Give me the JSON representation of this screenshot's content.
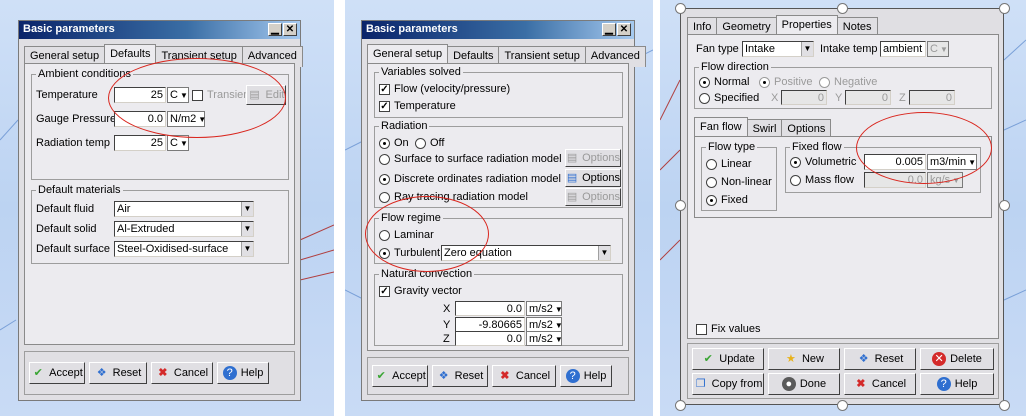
{
  "colors": {
    "title_bar": "#0a246a",
    "accent_ring": "#d9251d",
    "background_cad": "#c9dbf5"
  },
  "dialog1": {
    "title": "Basic parameters",
    "tabs": [
      "General setup",
      "Defaults",
      "Transient setup",
      "Advanced"
    ],
    "active_tab": "Defaults",
    "ambient": {
      "legend": "Ambient conditions",
      "temperature_label": "Temperature",
      "temperature_value": "25",
      "temperature_unit": "C",
      "transient_label": "Transient",
      "edit_label": "Edit",
      "gauge_label": "Gauge Pressure",
      "gauge_value": "0.0",
      "gauge_unit": "N/m2",
      "radiation_label": "Radiation temp",
      "radiation_value": "25",
      "radiation_unit": "C"
    },
    "materials": {
      "legend": "Default materials",
      "fluid_label": "Default fluid",
      "fluid_value": "Air",
      "solid_label": "Default solid",
      "solid_value": "Al-Extruded",
      "surface_label": "Default surface",
      "surface_value": "Steel-Oxidised-surface"
    },
    "buttons": {
      "accept": "Accept",
      "reset": "Reset",
      "cancel": "Cancel",
      "help": "Help"
    }
  },
  "dialog2": {
    "title": "Basic parameters",
    "tabs": [
      "General setup",
      "Defaults",
      "Transient setup",
      "Advanced"
    ],
    "active_tab": "General setup",
    "variables": {
      "legend": "Variables solved",
      "flow_label": "Flow (velocity/pressure)",
      "temperature_label": "Temperature"
    },
    "radiation": {
      "legend": "Radiation",
      "on_label": "On",
      "off_label": "Off",
      "s2s_label": "Surface to surface radiation model",
      "do_label": "Discrete ordinates radiation model",
      "ray_label": "Ray tracing radiation model",
      "options_label": "Options"
    },
    "flow_regime": {
      "legend": "Flow regime",
      "laminar_label": "Laminar",
      "turbulent_label": "Turbulent",
      "turbulent_model": "Zero equation"
    },
    "convection": {
      "legend": "Natural convection",
      "gravity_label": "Gravity vector",
      "x_label": "X",
      "x_value": "0.0",
      "x_unit": "m/s2",
      "y_label": "Y",
      "y_value": "-9.80665",
      "y_unit": "m/s2",
      "z_label": "Z",
      "z_value": "0.0",
      "z_unit": "m/s2"
    },
    "buttons": {
      "accept": "Accept",
      "reset": "Reset",
      "cancel": "Cancel",
      "help": "Help"
    }
  },
  "dialog3": {
    "tabs": [
      "Info",
      "Geometry",
      "Properties",
      "Notes"
    ],
    "active_tab": "Properties",
    "fan_type_label": "Fan type",
    "fan_type_value": "Intake",
    "intake_temp_label": "Intake temp",
    "intake_temp_value": "ambient",
    "intake_temp_unit": "C",
    "flow_direction": {
      "legend": "Flow direction",
      "normal_label": "Normal",
      "positive_label": "Positive",
      "negative_label": "Negative",
      "specified_label": "Specified",
      "x_label": "X",
      "x_value": "0",
      "y_label": "Y",
      "y_value": "0",
      "z_label": "Z",
      "z_value": "0"
    },
    "subtabs": [
      "Fan flow",
      "Swirl",
      "Options"
    ],
    "active_subtab": "Fan flow",
    "flow_type": {
      "legend": "Flow type",
      "linear_label": "Linear",
      "nonlinear_label": "Non-linear",
      "fixed_label": "Fixed"
    },
    "fixed_flow": {
      "legend": "Fixed flow",
      "volumetric_label": "Volumetric",
      "volumetric_value": "0.005",
      "volumetric_unit": "m3/min",
      "massflow_label": "Mass flow",
      "massflow_value": "0.0",
      "massflow_unit": "kg/s"
    },
    "fix_values_label": "Fix values",
    "buttons": {
      "update": "Update",
      "new": "New",
      "reset": "Reset",
      "delete": "Delete",
      "copy_from": "Copy from",
      "done": "Done",
      "cancel": "Cancel",
      "help": "Help"
    }
  }
}
